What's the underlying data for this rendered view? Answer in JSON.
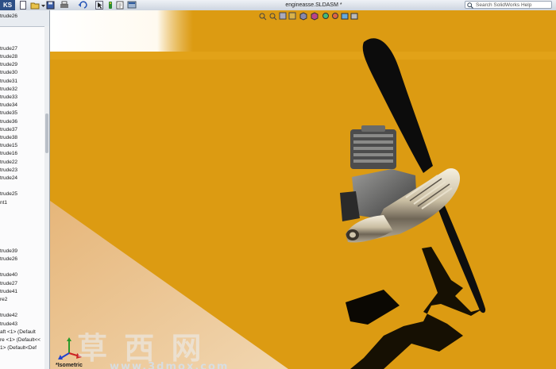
{
  "app": {
    "tab_label": "KS",
    "document_title": "engineasse.SLDASM *",
    "help_search_placeholder": "Search SolidWorks Help"
  },
  "feature_tree": {
    "items": [
      "trude26",
      "",
      "",
      "",
      "trude27",
      "trude28",
      "trude29",
      "trude30",
      "trude31",
      "trude32",
      "trude33",
      "trude34",
      "trude35",
      "trude36",
      "trude37",
      "trude38",
      "trude15",
      "trude16",
      "trude22",
      "trude23",
      "trude24",
      "",
      "trude25",
      "nt1",
      "",
      "",
      "",
      "",
      "",
      "trude39",
      "trude26",
      "",
      "trude40",
      "trude27",
      "trude41",
      "re2",
      "",
      "trude42",
      "trude43",
      "aft <1> (Default",
      "re <1> (Default<<",
      "1> (Default<Def"
    ]
  },
  "viewport": {
    "orientation": "*Isometric",
    "watermark_text": "草 西 网",
    "watermark_url": "www.3dmox.com",
    "colors": {
      "floor_primary": "#dc9b12",
      "floor_light": "#edc99a",
      "shadow": "#0b0803"
    }
  },
  "icons": {
    "toolbar": [
      "new-document-icon",
      "open-icon",
      "save-icon",
      "print-icon",
      "undo-icon",
      "select-icon",
      "rebuild-icon",
      "file-properties-icon",
      "options-icon"
    ],
    "view": [
      "zoom-to-fit-icon",
      "zoom-area-icon",
      "previous-view-icon",
      "section-view-icon",
      "view-orientation-icon",
      "display-style-icon",
      "hide-show-icon",
      "edit-appearance-icon",
      "apply-scene-icon",
      "view-settings-icon"
    ]
  }
}
